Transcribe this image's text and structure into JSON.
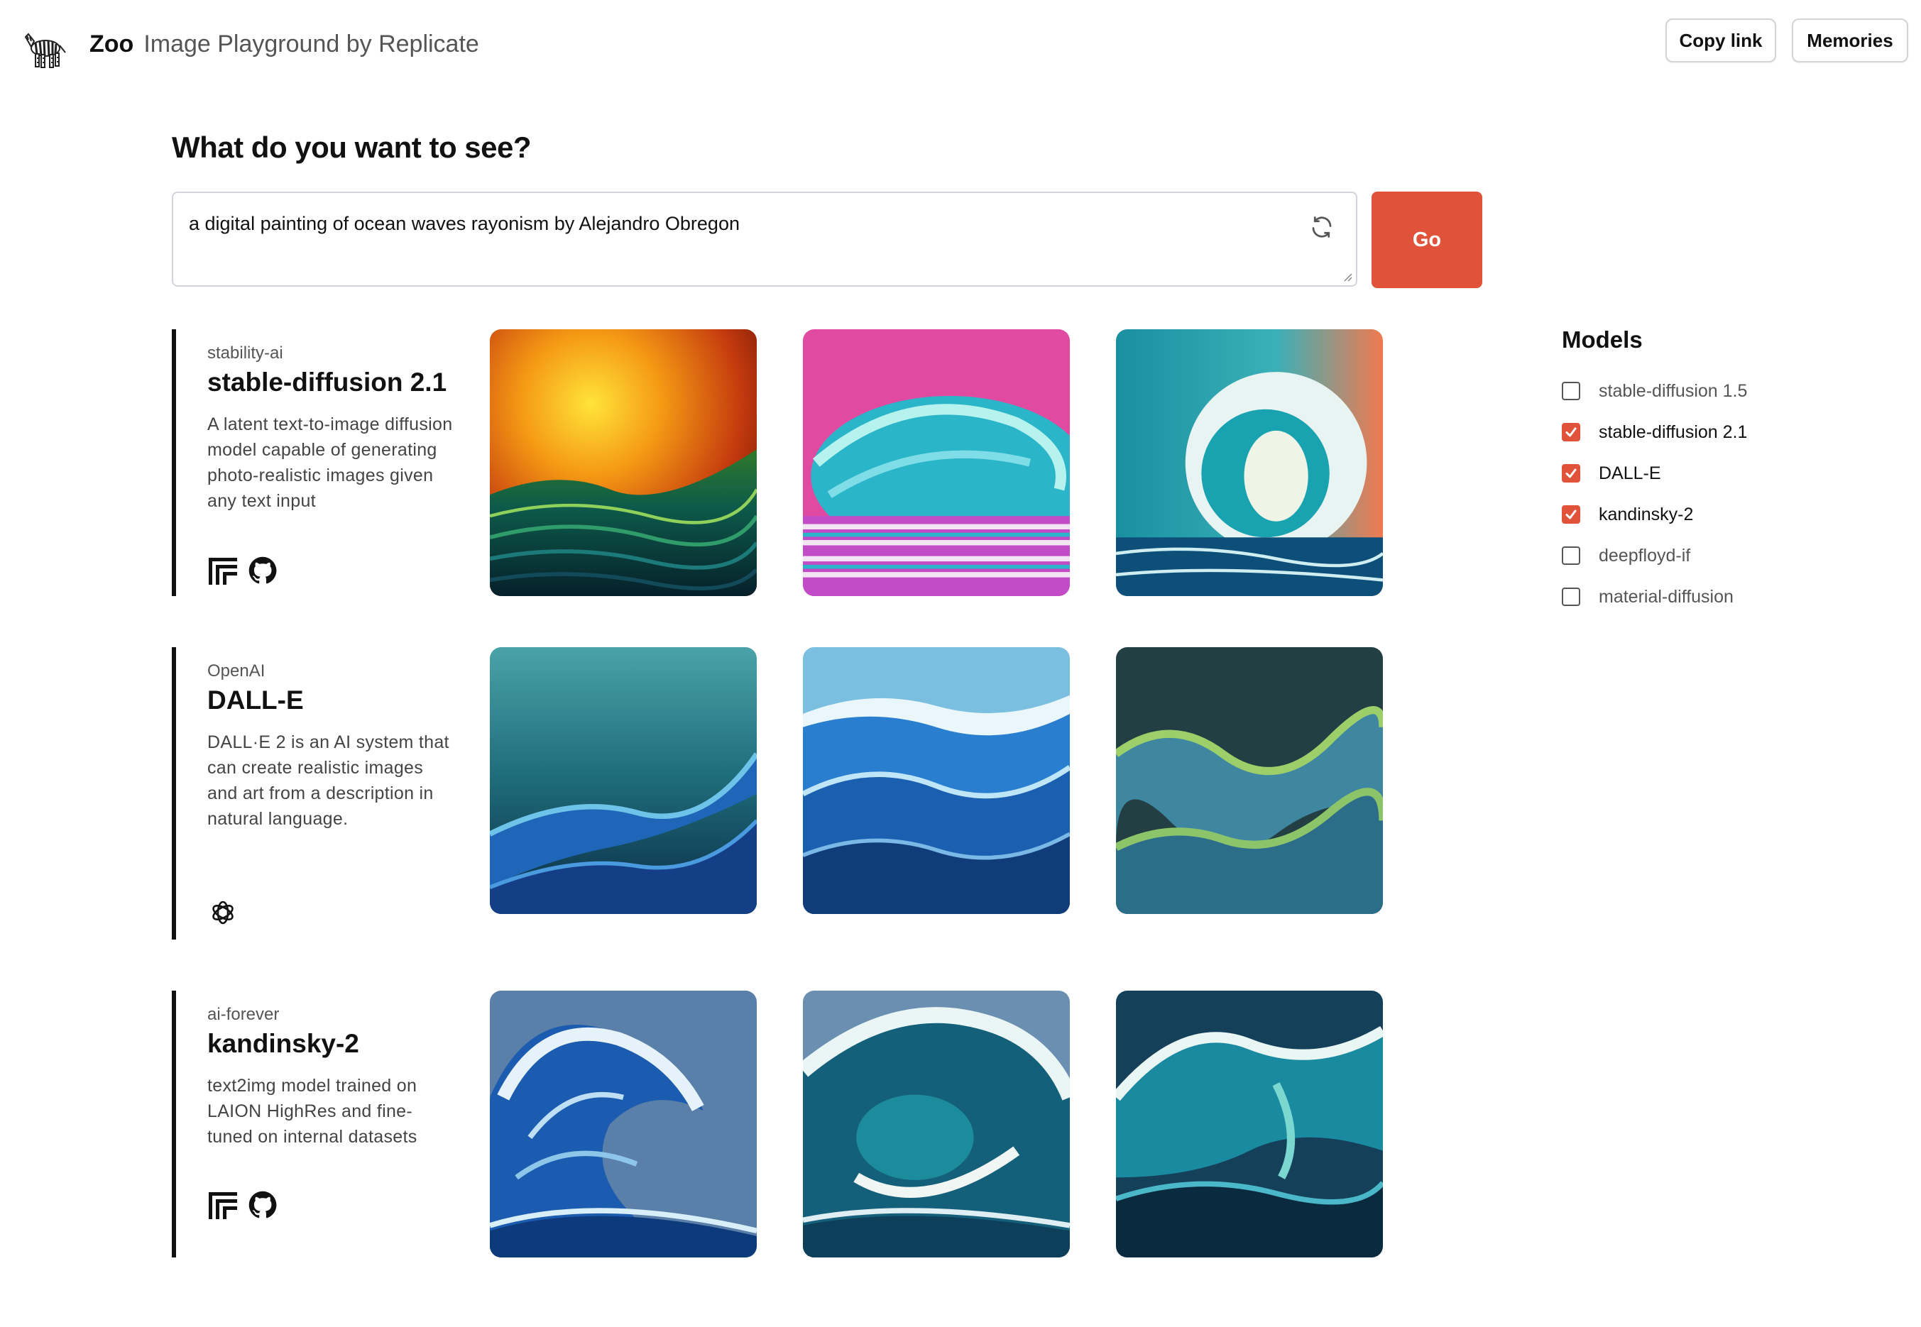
{
  "header": {
    "brand_name": "Zoo",
    "brand_subtitle": "Image Playground by Replicate",
    "copy_link_label": "Copy link",
    "memories_label": "Memories"
  },
  "prompt": {
    "heading": "What do you want to see?",
    "value": "a digital painting of ocean waves rayonism by Alejandro Obregon",
    "go_label": "Go"
  },
  "results": [
    {
      "owner": "stability-ai",
      "name": "stable-diffusion 2.1",
      "description": "A latent text-to-image diffusion model capable of generating photo-realistic images given any text input",
      "links": [
        "replicate-icon",
        "github-icon"
      ]
    },
    {
      "owner": "OpenAI",
      "name": "DALL-E",
      "description": "DALL·E 2 is an AI system that can create realistic images and art from a description in natural language.",
      "links": [
        "openai-icon"
      ]
    },
    {
      "owner": "ai-forever",
      "name": "kandinsky-2",
      "description": "text2img model trained on LAION HighRes and fine-tuned on internal datasets",
      "links": [
        "replicate-icon",
        "github-icon"
      ]
    }
  ],
  "models_panel": {
    "title": "Models",
    "items": [
      {
        "label": "stable-diffusion 1.5",
        "checked": false
      },
      {
        "label": "stable-diffusion 2.1",
        "checked": true
      },
      {
        "label": "DALL-E",
        "checked": true
      },
      {
        "label": "kandinsky-2",
        "checked": true
      },
      {
        "label": "deepfloyd-if",
        "checked": false
      },
      {
        "label": "material-diffusion",
        "checked": false
      }
    ]
  },
  "colors": {
    "accent": "#e0533a",
    "text": "#111827",
    "muted": "#555555",
    "border": "#d1d5db"
  }
}
